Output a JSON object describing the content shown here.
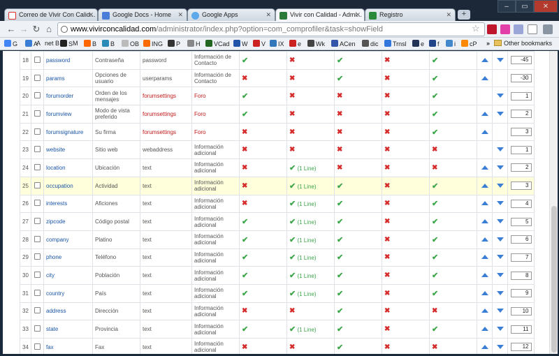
{
  "tabs": [
    {
      "label": "Correo de Vivir Con Calid...",
      "favicon": "gmail-icon",
      "color": "#d93025"
    },
    {
      "label": "Google Docs - Home",
      "favicon": "docs-icon",
      "color": "#4a7dd8"
    },
    {
      "label": "Google Apps",
      "favicon": "apps-icon",
      "color": "#5da9e9"
    },
    {
      "label": "Vivir con Calidad - Admi...",
      "favicon": "joomla-icon",
      "color": "#2b7a3a",
      "active": true
    },
    {
      "label": "Registro",
      "favicon": "registro-icon",
      "color": "#2a8a3a"
    }
  ],
  "url": {
    "domain": "www.vivirconcalidad.com",
    "path": "/administrator/index.php?option=com_comprofiler&task=showField"
  },
  "bookmarks": [
    {
      "label": "G",
      "color": "#4285f4"
    },
    {
      "label": "A",
      "color": "#3b7ed6"
    },
    {
      "label": "A",
      "color": "#999999"
    },
    {
      "label": "net B",
      "color": "#335599"
    },
    {
      "label": "S",
      "color": "#222222"
    },
    {
      "label": "M",
      "color": "#1f6ec6"
    },
    {
      "label": "B",
      "color": "#ff6600"
    },
    {
      "label": "B",
      "color": "#2a8ab8"
    },
    {
      "label": "OB",
      "color": "#bbbbbb"
    },
    {
      "label": "ING",
      "color": "#ff6a00"
    },
    {
      "label": "P",
      "color": "#333333"
    },
    {
      "label": "H",
      "color": "#888888"
    },
    {
      "label": "VCad",
      "color": "#226622"
    },
    {
      "label": "W",
      "color": "#2255aa"
    },
    {
      "label": "V",
      "color": "#cc2222"
    },
    {
      "label": "IX",
      "color": "#3377bb"
    },
    {
      "label": "e",
      "color": "#cc2222"
    },
    {
      "label": "Wk",
      "color": "#444444"
    },
    {
      "label": "ACen",
      "color": "#3355aa"
    },
    {
      "label": "dic",
      "color": "#555555"
    },
    {
      "label": "Trnsl",
      "color": "#3377dd"
    },
    {
      "label": "e",
      "color": "#223355"
    },
    {
      "label": "f",
      "color": "#224488"
    },
    {
      "label": "i",
      "color": "#4488cc"
    },
    {
      "label": "cP",
      "color": "#ff8800"
    }
  ],
  "other_bookmarks": "Other bookmarks",
  "line_label": "(1 Line)",
  "rows": [
    {
      "n": "18",
      "name": "password",
      "title": "Contraseña",
      "type": "password",
      "tab": "Información de Contacto",
      "tab_red": false,
      "f": [
        "ok",
        "no",
        "ok",
        "no",
        "ok"
      ],
      "lines": [
        false,
        false
      ],
      "up": true,
      "down": true,
      "order": "-45",
      "hl": false
    },
    {
      "n": "19",
      "name": "params",
      "title": "Opciones de usuario",
      "type": "userparams",
      "tab": "Información de Contacto",
      "tab_red": false,
      "f": [
        "no",
        "no",
        "ok",
        "no",
        "ok"
      ],
      "lines": [
        false,
        false
      ],
      "up": true,
      "down": false,
      "order": "-30",
      "hl": false
    },
    {
      "n": "20",
      "name": "forumorder",
      "title": "Orden de los mensajes",
      "type": "forumsettings",
      "type_red": true,
      "tab": "Foro",
      "tab_red": true,
      "f": [
        "ok",
        "no",
        "no",
        "no",
        "ok"
      ],
      "lines": [
        false,
        false
      ],
      "up": false,
      "down": true,
      "order": "1",
      "hl": false
    },
    {
      "n": "21",
      "name": "forumview",
      "title": "Modo de vista preferido",
      "type": "forumsettings",
      "type_red": true,
      "tab": "Foro",
      "tab_red": true,
      "f": [
        "ok",
        "no",
        "no",
        "no",
        "ok"
      ],
      "lines": [
        false,
        false
      ],
      "up": true,
      "down": true,
      "order": "2",
      "hl": false
    },
    {
      "n": "22",
      "name": "forumsignature",
      "title": "Su firma",
      "type": "forumsettings",
      "type_red": true,
      "tab": "Foro",
      "tab_red": true,
      "f": [
        "no",
        "no",
        "no",
        "no",
        "ok"
      ],
      "lines": [
        false,
        false
      ],
      "up": true,
      "down": false,
      "order": "3",
      "hl": false
    },
    {
      "n": "23",
      "name": "website",
      "title": "Sitio web",
      "type": "webaddress",
      "tab": "Información adicional",
      "tab_red": false,
      "f": [
        "no",
        "no",
        "no",
        "no",
        "no"
      ],
      "lines": [
        false,
        false
      ],
      "up": false,
      "down": true,
      "order": "1",
      "hl": false
    },
    {
      "n": "24",
      "name": "location",
      "title": "Ubicación",
      "type": "text",
      "tab": "Información adicional",
      "tab_red": false,
      "f": [
        "no",
        "ok",
        "no",
        "no",
        "no"
      ],
      "lines": [
        true,
        false
      ],
      "up": true,
      "down": true,
      "order": "2",
      "hl": false
    },
    {
      "n": "25",
      "name": "occupation",
      "title": "Actividad",
      "type": "text",
      "tab": "Información adicional",
      "tab_red": false,
      "f": [
        "no",
        "ok",
        "ok",
        "no",
        "ok"
      ],
      "lines": [
        true,
        false
      ],
      "up": true,
      "down": true,
      "order": "3",
      "hl": true
    },
    {
      "n": "26",
      "name": "interests",
      "title": "Aficiones",
      "type": "text",
      "tab": "Información adicional",
      "tab_red": false,
      "f": [
        "no",
        "ok",
        "ok",
        "no",
        "ok"
      ],
      "lines": [
        true,
        false
      ],
      "up": true,
      "down": true,
      "order": "4",
      "hl": false
    },
    {
      "n": "27",
      "name": "zipcode",
      "title": "Código postal",
      "type": "text",
      "tab": "Información adicional",
      "tab_red": false,
      "f": [
        "ok",
        "ok",
        "ok",
        "no",
        "ok"
      ],
      "lines": [
        true,
        false
      ],
      "up": true,
      "down": true,
      "order": "5",
      "hl": false
    },
    {
      "n": "28",
      "name": "company",
      "title": "Platino",
      "type": "text",
      "tab": "Información adicional",
      "tab_red": false,
      "f": [
        "ok",
        "ok",
        "ok",
        "no",
        "ok"
      ],
      "lines": [
        true,
        false
      ],
      "up": true,
      "down": true,
      "order": "6",
      "hl": false
    },
    {
      "n": "29",
      "name": "phone",
      "title": "Teléfono",
      "type": "text",
      "tab": "Información adicional",
      "tab_red": false,
      "f": [
        "ok",
        "ok",
        "ok",
        "no",
        "ok"
      ],
      "lines": [
        true,
        false
      ],
      "up": true,
      "down": true,
      "order": "7",
      "hl": false
    },
    {
      "n": "30",
      "name": "city",
      "title": "Población",
      "type": "text",
      "tab": "Información adicional",
      "tab_red": false,
      "f": [
        "ok",
        "ok",
        "ok",
        "no",
        "ok"
      ],
      "lines": [
        true,
        false
      ],
      "up": true,
      "down": true,
      "order": "8",
      "hl": false
    },
    {
      "n": "31",
      "name": "country",
      "title": "País",
      "type": "text",
      "tab": "Información adicional",
      "tab_red": false,
      "f": [
        "ok",
        "ok",
        "ok",
        "no",
        "ok"
      ],
      "lines": [
        true,
        false
      ],
      "up": true,
      "down": true,
      "order": "9",
      "hl": false
    },
    {
      "n": "32",
      "name": "address",
      "title": "Dirección",
      "type": "text",
      "tab": "Información adicional",
      "tab_red": false,
      "f": [
        "no",
        "no",
        "ok",
        "no",
        "no"
      ],
      "lines": [
        false,
        false
      ],
      "up": true,
      "down": true,
      "order": "10",
      "hl": false
    },
    {
      "n": "33",
      "name": "state",
      "title": "Provincia",
      "type": "text",
      "tab": "Información adicional",
      "tab_red": false,
      "f": [
        "ok",
        "ok",
        "ok",
        "no",
        "ok"
      ],
      "lines": [
        true,
        false
      ],
      "up": true,
      "down": true,
      "order": "11",
      "hl": false
    },
    {
      "n": "34",
      "name": "fax",
      "title": "Fax",
      "type": "text",
      "tab": "Información adicional",
      "tab_red": false,
      "f": [
        "no",
        "no",
        "ok",
        "no",
        "no"
      ],
      "lines": [
        false,
        false
      ],
      "up": true,
      "down": true,
      "order": "12",
      "hl": false
    }
  ]
}
